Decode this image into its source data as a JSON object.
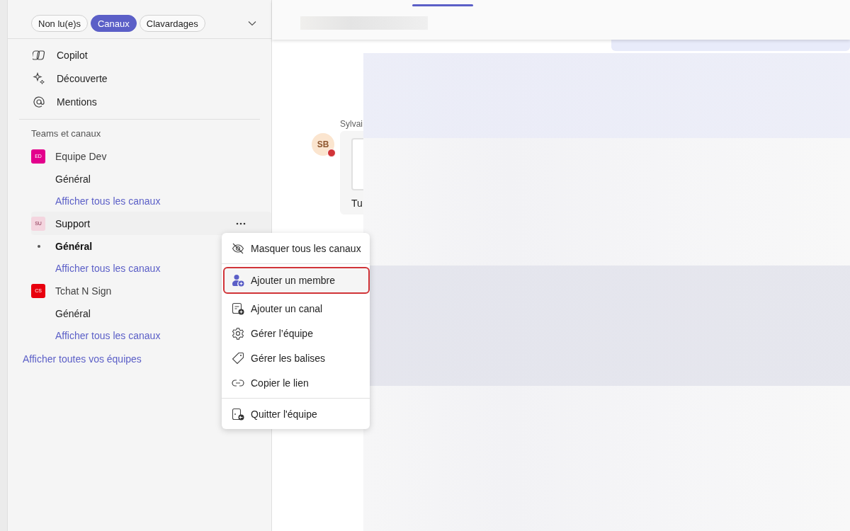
{
  "filters": [
    {
      "label": "Non lu(e)s",
      "selected": false
    },
    {
      "label": "Canaux",
      "selected": true
    },
    {
      "label": "Clavardages",
      "selected": false
    }
  ],
  "nav": [
    {
      "label": "Copilot"
    },
    {
      "label": "Découverte"
    },
    {
      "label": "Mentions"
    }
  ],
  "section_title": "Teams et canaux",
  "teams": [
    {
      "initials": "ED",
      "color": "#e3008c",
      "name": "Equipe Dev",
      "hovered": false,
      "channels": [
        {
          "name": "Général",
          "selected": false
        }
      ],
      "link": "Afficher tous les canaux"
    },
    {
      "initials": "SU",
      "color": "#f4d5df",
      "name": "Support",
      "hovered": true,
      "channels": [
        {
          "name": "Général",
          "selected": true
        }
      ],
      "link": "Afficher tous les canaux"
    },
    {
      "initials": "CS",
      "color": "#e8000e",
      "name": "Tchat N Sign",
      "hovered": false,
      "channels": [
        {
          "name": "Général",
          "selected": false
        }
      ],
      "link": "Afficher tous les canaux"
    }
  ],
  "all_teams_link": "Afficher toutes vos équipes",
  "context_menu": [
    {
      "kind": "item",
      "label": "Masquer tous les canaux",
      "selected": false
    },
    {
      "kind": "separator"
    },
    {
      "kind": "item",
      "label": "Ajouter un membre",
      "selected": true
    },
    {
      "kind": "item",
      "label": "Ajouter un canal",
      "selected": false
    },
    {
      "kind": "item",
      "label": "Gérer l’équipe",
      "selected": false
    },
    {
      "kind": "item",
      "label": "Gérer les balises",
      "selected": false
    },
    {
      "kind": "item",
      "label": "Copier le lien",
      "selected": false
    },
    {
      "kind": "separator"
    },
    {
      "kind": "item",
      "label": "Quitter l'équipe",
      "selected": false
    }
  ],
  "chat": {
    "avatar_initials": "SB",
    "sender": "Sylvai",
    "message": "Tu"
  }
}
